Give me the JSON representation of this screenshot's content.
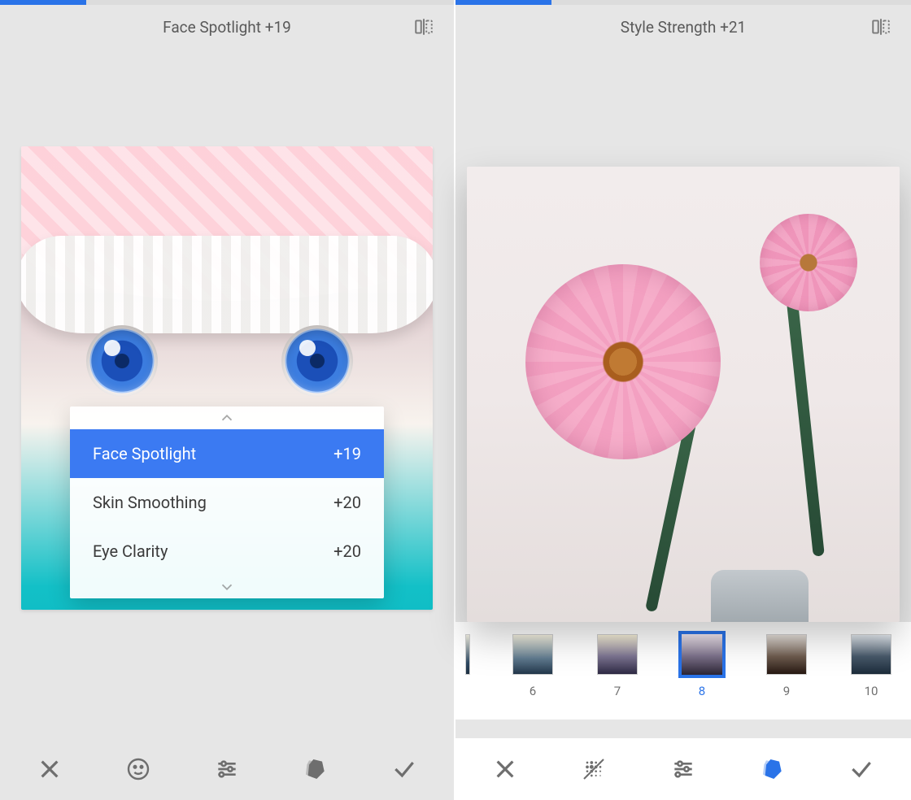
{
  "colors": {
    "accent": "#2a73e8"
  },
  "left": {
    "progress_pct": 19,
    "header_title": "Face Spotlight +19",
    "params": [
      {
        "label": "Face Spotlight",
        "value": "+19",
        "selected": true
      },
      {
        "label": "Skin Smoothing",
        "value": "+20",
        "selected": false
      },
      {
        "label": "Eye Clarity",
        "value": "+20",
        "selected": false
      }
    ],
    "toolbar": {
      "cancel": "close",
      "face": "face",
      "adjust": "tune",
      "styles": "swatch",
      "apply": "check",
      "active": "face"
    }
  },
  "right": {
    "progress_pct": 21,
    "header_title": "Style Strength +21",
    "styles": {
      "selected": "8",
      "items": [
        {
          "id": "5",
          "label": "",
          "partial": true
        },
        {
          "id": "6",
          "label": "6",
          "partial": false
        },
        {
          "id": "7",
          "label": "7",
          "partial": false
        },
        {
          "id": "8",
          "label": "8",
          "partial": false
        },
        {
          "id": "9",
          "label": "9",
          "partial": false
        },
        {
          "id": "10",
          "label": "10",
          "partial": false
        },
        {
          "id": "11",
          "label": "",
          "partial": true
        }
      ]
    },
    "toolbar": {
      "cancel": "close",
      "blur": "blur",
      "adjust": "tune",
      "styles": "swatch",
      "apply": "check",
      "active": "styles"
    }
  }
}
